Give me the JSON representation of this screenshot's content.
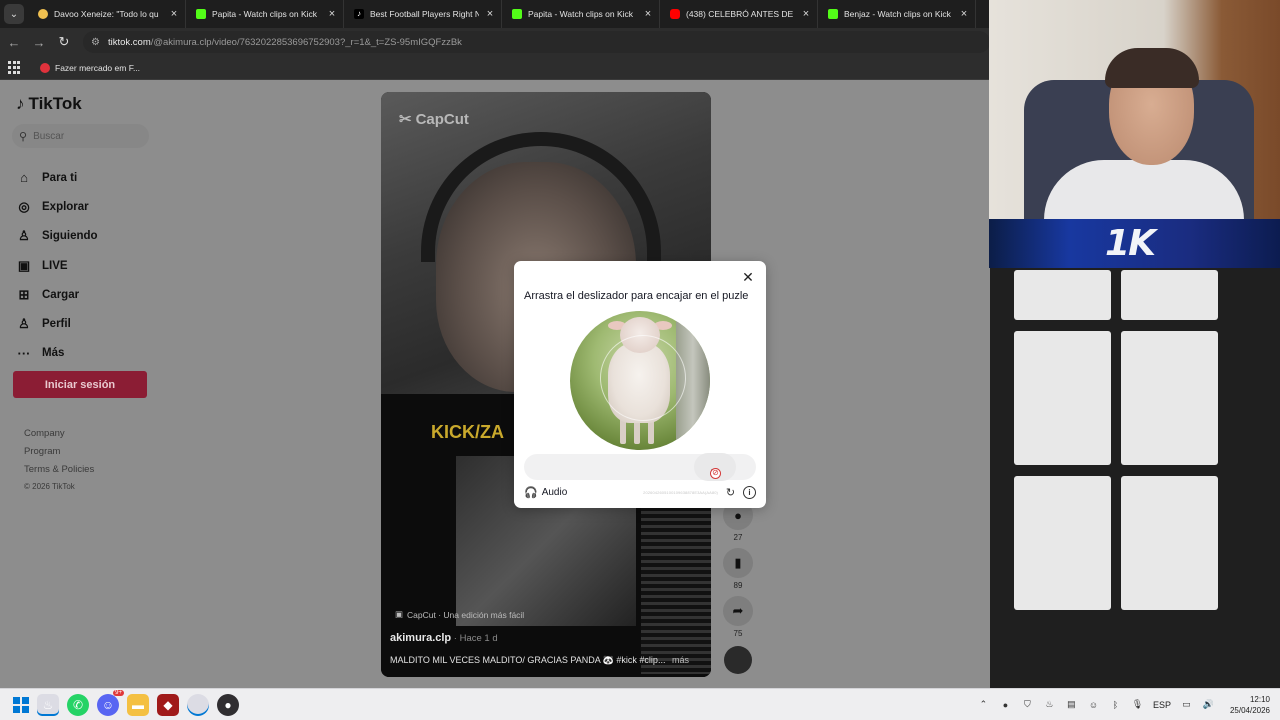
{
  "browser": {
    "tabs": [
      {
        "title": "Davoo Xeneize: \"Todo lo qu",
        "favicon": "tiktok-favicon"
      },
      {
        "title": "Papita - Watch clips on Kick",
        "favicon": "kick-favicon"
      },
      {
        "title": "Best Football Players Right Now",
        "favicon": "tiktok-favicon"
      },
      {
        "title": "Papita - Watch clips on Kick",
        "favicon": "kick-favicon"
      },
      {
        "title": "(438) CELEBRÓ ANTES DE TIEM",
        "favicon": "youtube-favicon"
      },
      {
        "title": "Benjaz - Watch clips on Kick",
        "favicon": "kick-favicon"
      }
    ],
    "url_host": "tiktok.com",
    "url_path": "/@akimura.clp/video/7632022853696752903?_r=1&_t=ZS-95mIGQFzzBk",
    "bookmark": "Fazer mercado em F..."
  },
  "sidebar": {
    "logo": "TikTok",
    "search_placeholder": "Buscar",
    "nav": [
      {
        "label": "Para ti",
        "icon": "home-icon"
      },
      {
        "label": "Explorar",
        "icon": "compass-icon"
      },
      {
        "label": "Siguiendo",
        "icon": "following-icon"
      },
      {
        "label": "LIVE",
        "icon": "live-icon"
      },
      {
        "label": "Cargar",
        "icon": "upload-icon"
      },
      {
        "label": "Perfil",
        "icon": "profile-icon"
      },
      {
        "label": "Más",
        "icon": "more-icon"
      }
    ],
    "login": "Iniciar sesión",
    "footer": [
      "Company",
      "Program",
      "Terms & Policies"
    ],
    "copyright": "© 2026 TikTok"
  },
  "video": {
    "watermark": "CapCut",
    "kick_text": "KICK/ZA",
    "capcut_note": "CapCut · Una edición más fácil",
    "author": "akimura.clp",
    "time": " · Hace 1 d",
    "description": "MALDITO MIL VECES MALDITO/ GRACIAS PANDA 🐼 #kick #clip...",
    "more": "más",
    "actions": {
      "comments": "27",
      "saves": "89",
      "shares": "75"
    }
  },
  "captcha": {
    "title": "Arrastra el deslizador para encajar en el puzle",
    "audio": "Audio",
    "id": "2026042605100109638878E3AA(AA80)"
  },
  "webcam": {
    "logo": "1K"
  },
  "taskbar": {
    "language": "ESP",
    "time": "12:10",
    "date": "25/04/2026",
    "discord_badge": "9+"
  }
}
